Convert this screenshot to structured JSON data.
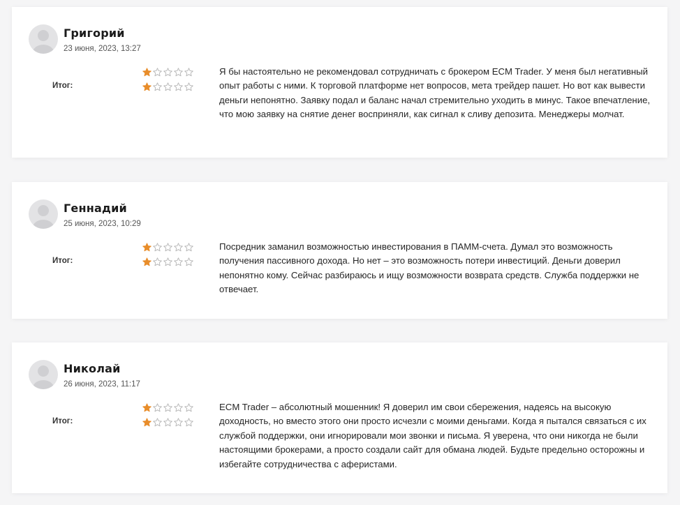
{
  "labels": {
    "total": "Итог:"
  },
  "rating_star_color": "#e88d2a",
  "rating_star_empty_color": "#b5b5b5",
  "reviews": [
    {
      "author": "Григорий",
      "date": "23 июня, 2023, 13:27",
      "rating_row_1": 1,
      "rating_total": 1,
      "max_rating": 5,
      "text": "Я бы настоятельно не рекомендовал сотрудничать с брокером ECM Trader. У меня был негативный опыт работы с ними. К торговой платформе нет вопросов, мета трейдер пашет. Но вот как вывести деньги непонятно. Заявку подал и баланс начал стремительно уходить в минус. Такое впечатление, что мою заявку на снятие денег восприняли, как сигнал к сливу депозита. Менеджеры молчат."
    },
    {
      "author": "Геннадий",
      "date": "25 июня, 2023, 10:29",
      "rating_row_1": 1,
      "rating_total": 1,
      "max_rating": 5,
      "text": "Посредник заманил возможностью инвестирования в ПАММ-счета. Думал это возможность получения пассивного дохода. Но нет – это возможность потери инвестиций. Деньги доверил непонятно кому. Сейчас разбираюсь и ищу возможности возврата средств. Служба поддержки не отвечает."
    },
    {
      "author": "Николай",
      "date": "26 июня, 2023, 11:17",
      "rating_row_1": 1,
      "rating_total": 1,
      "max_rating": 5,
      "text": "ECM Trader – абсолютный мошенник! Я доверил им свои сбережения, надеясь на высокую доходность, но вместо этого они просто исчезли с моими деньгами. Когда я пытался связаться с их службой поддержки, они игнорировали мои звонки и письма. Я уверена, что они никогда не были настоящими брокерами, а просто создали сайт для обмана людей. Будьте предельно осторожны и избегайте сотрудничества с аферистами."
    }
  ]
}
